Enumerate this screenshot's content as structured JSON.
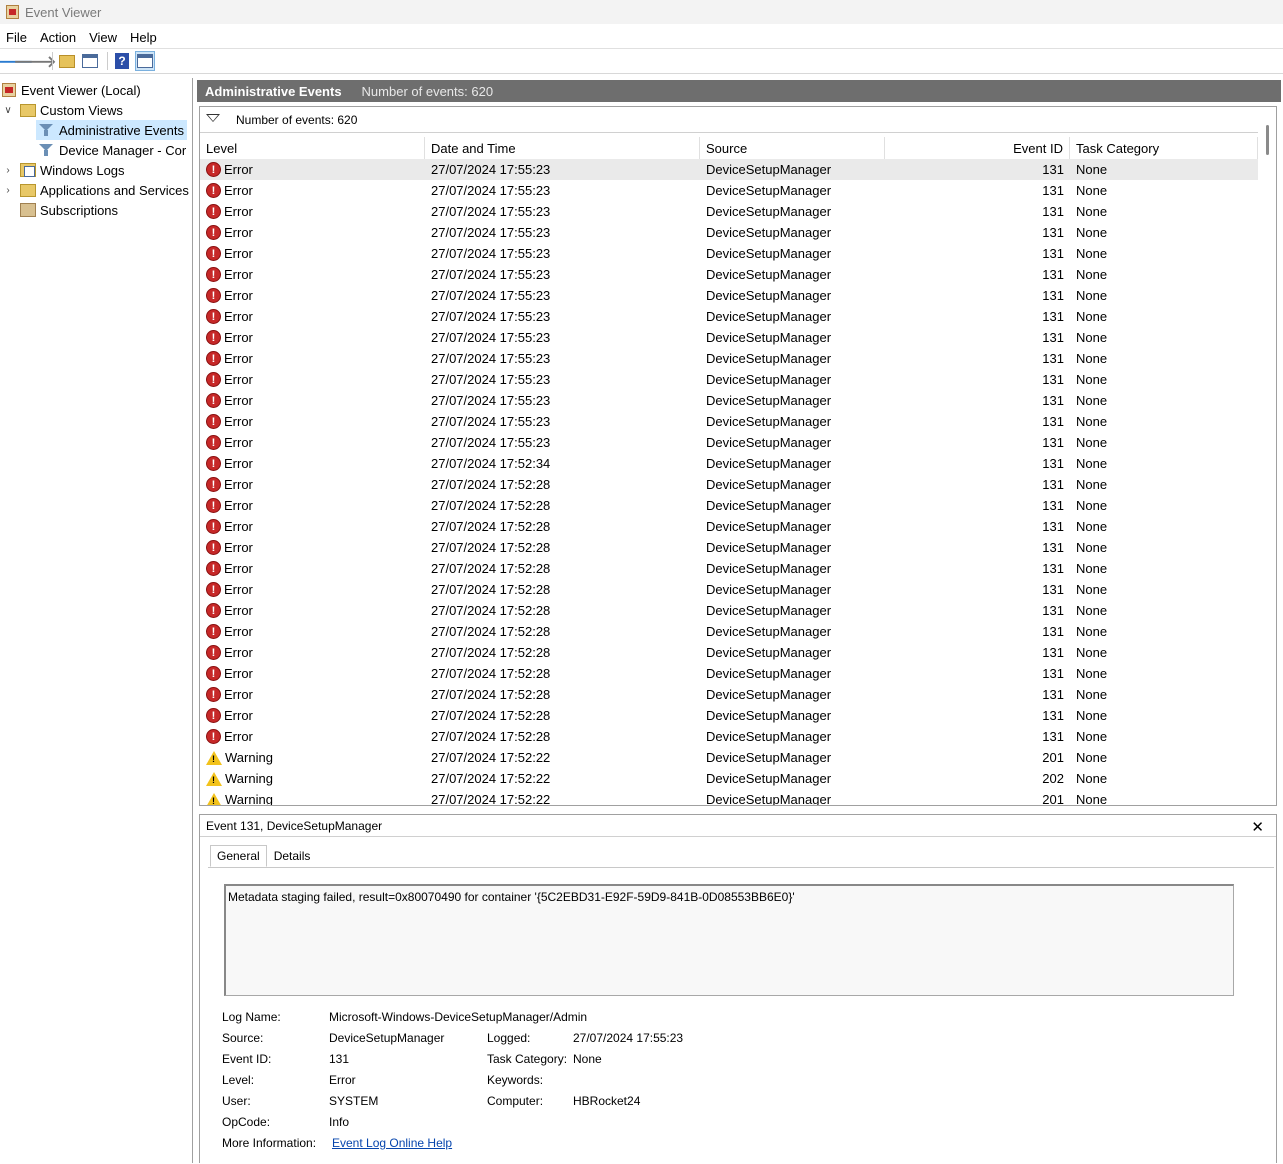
{
  "window": {
    "title": "Event Viewer"
  },
  "menu": [
    "File",
    "Action",
    "View",
    "Help"
  ],
  "tree": {
    "root": "Event Viewer (Local)",
    "custom_views": "Custom Views",
    "administrative_events": "Administrative Events",
    "device_manager": "Device Manager - Cor",
    "windows_logs": "Windows Logs",
    "apps_services": "Applications and Services",
    "subscriptions": "Subscriptions"
  },
  "header": {
    "title": "Administrative Events",
    "count": "Number of events: 620"
  },
  "filter": {
    "text": "Number of events: 620"
  },
  "columns": {
    "level": "Level",
    "date": "Date and Time",
    "source": "Source",
    "event_id": "Event ID",
    "task": "Task Category"
  },
  "events": [
    {
      "level": "Error",
      "date": "27/07/2024 17:55:23",
      "source": "DeviceSetupManager",
      "id": "131",
      "task": "None"
    },
    {
      "level": "Error",
      "date": "27/07/2024 17:55:23",
      "source": "DeviceSetupManager",
      "id": "131",
      "task": "None"
    },
    {
      "level": "Error",
      "date": "27/07/2024 17:55:23",
      "source": "DeviceSetupManager",
      "id": "131",
      "task": "None"
    },
    {
      "level": "Error",
      "date": "27/07/2024 17:55:23",
      "source": "DeviceSetupManager",
      "id": "131",
      "task": "None"
    },
    {
      "level": "Error",
      "date": "27/07/2024 17:55:23",
      "source": "DeviceSetupManager",
      "id": "131",
      "task": "None"
    },
    {
      "level": "Error",
      "date": "27/07/2024 17:55:23",
      "source": "DeviceSetupManager",
      "id": "131",
      "task": "None"
    },
    {
      "level": "Error",
      "date": "27/07/2024 17:55:23",
      "source": "DeviceSetupManager",
      "id": "131",
      "task": "None"
    },
    {
      "level": "Error",
      "date": "27/07/2024 17:55:23",
      "source": "DeviceSetupManager",
      "id": "131",
      "task": "None"
    },
    {
      "level": "Error",
      "date": "27/07/2024 17:55:23",
      "source": "DeviceSetupManager",
      "id": "131",
      "task": "None"
    },
    {
      "level": "Error",
      "date": "27/07/2024 17:55:23",
      "source": "DeviceSetupManager",
      "id": "131",
      "task": "None"
    },
    {
      "level": "Error",
      "date": "27/07/2024 17:55:23",
      "source": "DeviceSetupManager",
      "id": "131",
      "task": "None"
    },
    {
      "level": "Error",
      "date": "27/07/2024 17:55:23",
      "source": "DeviceSetupManager",
      "id": "131",
      "task": "None"
    },
    {
      "level": "Error",
      "date": "27/07/2024 17:55:23",
      "source": "DeviceSetupManager",
      "id": "131",
      "task": "None"
    },
    {
      "level": "Error",
      "date": "27/07/2024 17:55:23",
      "source": "DeviceSetupManager",
      "id": "131",
      "task": "None"
    },
    {
      "level": "Error",
      "date": "27/07/2024 17:52:34",
      "source": "DeviceSetupManager",
      "id": "131",
      "task": "None"
    },
    {
      "level": "Error",
      "date": "27/07/2024 17:52:28",
      "source": "DeviceSetupManager",
      "id": "131",
      "task": "None"
    },
    {
      "level": "Error",
      "date": "27/07/2024 17:52:28",
      "source": "DeviceSetupManager",
      "id": "131",
      "task": "None"
    },
    {
      "level": "Error",
      "date": "27/07/2024 17:52:28",
      "source": "DeviceSetupManager",
      "id": "131",
      "task": "None"
    },
    {
      "level": "Error",
      "date": "27/07/2024 17:52:28",
      "source": "DeviceSetupManager",
      "id": "131",
      "task": "None"
    },
    {
      "level": "Error",
      "date": "27/07/2024 17:52:28",
      "source": "DeviceSetupManager",
      "id": "131",
      "task": "None"
    },
    {
      "level": "Error",
      "date": "27/07/2024 17:52:28",
      "source": "DeviceSetupManager",
      "id": "131",
      "task": "None"
    },
    {
      "level": "Error",
      "date": "27/07/2024 17:52:28",
      "source": "DeviceSetupManager",
      "id": "131",
      "task": "None"
    },
    {
      "level": "Error",
      "date": "27/07/2024 17:52:28",
      "source": "DeviceSetupManager",
      "id": "131",
      "task": "None"
    },
    {
      "level": "Error",
      "date": "27/07/2024 17:52:28",
      "source": "DeviceSetupManager",
      "id": "131",
      "task": "None"
    },
    {
      "level": "Error",
      "date": "27/07/2024 17:52:28",
      "source": "DeviceSetupManager",
      "id": "131",
      "task": "None"
    },
    {
      "level": "Error",
      "date": "27/07/2024 17:52:28",
      "source": "DeviceSetupManager",
      "id": "131",
      "task": "None"
    },
    {
      "level": "Error",
      "date": "27/07/2024 17:52:28",
      "source": "DeviceSetupManager",
      "id": "131",
      "task": "None"
    },
    {
      "level": "Error",
      "date": "27/07/2024 17:52:28",
      "source": "DeviceSetupManager",
      "id": "131",
      "task": "None"
    },
    {
      "level": "Warning",
      "date": "27/07/2024 17:52:22",
      "source": "DeviceSetupManager",
      "id": "201",
      "task": "None"
    },
    {
      "level": "Warning",
      "date": "27/07/2024 17:52:22",
      "source": "DeviceSetupManager",
      "id": "202",
      "task": "None"
    },
    {
      "level": "Warning",
      "date": "27/07/2024 17:52:22",
      "source": "DeviceSetupManager",
      "id": "201",
      "task": "None"
    }
  ],
  "detail": {
    "title": "Event 131, DeviceSetupManager",
    "tab_general": "General",
    "tab_details": "Details",
    "message": "Metadata staging failed, result=0x80070490 for container '{5C2EBD31-E92F-59D9-841B-0D08553BB6E0}'",
    "log_name_label": "Log Name:",
    "log_name": "Microsoft-Windows-DeviceSetupManager/Admin",
    "source_label": "Source:",
    "source": "DeviceSetupManager",
    "logged_label": "Logged:",
    "logged": "27/07/2024 17:55:23",
    "event_id_label": "Event ID:",
    "event_id": "131",
    "task_label": "Task Category:",
    "task": "None",
    "level_label": "Level:",
    "level": "Error",
    "keywords_label": "Keywords:",
    "keywords": "",
    "user_label": "User:",
    "user": "SYSTEM",
    "computer_label": "Computer:",
    "computer": "HBRocket24",
    "opcode_label": "OpCode:",
    "opcode": "Info",
    "more_label": "More Information:",
    "more_link": "Event Log Online Help"
  },
  "colors": {
    "header_bg": "#6e6e6e",
    "selection": "#cce8ff",
    "error": "#c62828",
    "warning": "#f2c21b",
    "link": "#0645ad"
  }
}
